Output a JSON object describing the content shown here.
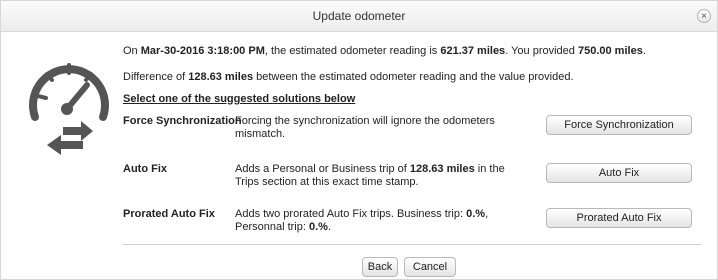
{
  "dialog": {
    "title": "Update odometer",
    "close_glyph": "×"
  },
  "summary": {
    "p1_prefix": "On ",
    "p1_date": "Mar-30-2016 3:18:00 PM",
    "p1_mid": ", the estimated odometer reading is ",
    "p1_estimated": "621.37 miles",
    "p1_mid2": ". You provided ",
    "p1_provided": "750.00 miles",
    "p1_end": ".",
    "p2_prefix": "Difference of ",
    "p2_diff": "128.63 miles",
    "p2_rest": " between the estimated odometer reading and the value provided.",
    "instructions": "Select one of the suggested solutions below"
  },
  "solutions": [
    {
      "name": "Force Synchronization",
      "desc_a": "Forcing the synchronization will ignore the odometers mismatch.",
      "desc_b": "",
      "desc_c": "",
      "button": "Force Synchronization"
    },
    {
      "name": "Auto Fix",
      "desc_a": "Adds a Personal or Business trip of ",
      "desc_b": "128.63 miles",
      "desc_c": " in the Trips section at this exact time stamp.",
      "button": "Auto Fix"
    },
    {
      "name": "Prorated Auto Fix",
      "desc_a": "Adds two prorated Auto Fix trips. Business trip: ",
      "desc_b": "0.%",
      "desc_c": ", Personnal trip: ",
      "desc_d": "0.%",
      "desc_e": ".",
      "button": "Prorated Auto Fix"
    }
  ],
  "footer": {
    "back_label": "Back",
    "cancel_label": "Cancel"
  },
  "icons": {
    "main": "odometer-icon",
    "sync": "swap-arrows-icon"
  },
  "colors": {
    "icon_gray": "#555555"
  }
}
